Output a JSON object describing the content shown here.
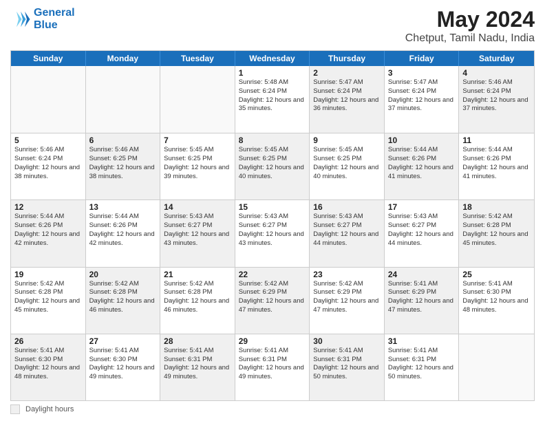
{
  "header": {
    "logo_line1": "General",
    "logo_line2": "Blue",
    "main_title": "May 2024",
    "subtitle": "Chetput, Tamil Nadu, India"
  },
  "weekdays": [
    "Sunday",
    "Monday",
    "Tuesday",
    "Wednesday",
    "Thursday",
    "Friday",
    "Saturday"
  ],
  "legend": {
    "box_label": "Daylight hours"
  },
  "weeks": [
    [
      {
        "day": "",
        "info": "",
        "empty": true
      },
      {
        "day": "",
        "info": "",
        "empty": true
      },
      {
        "day": "",
        "info": "",
        "empty": true
      },
      {
        "day": "1",
        "info": "Sunrise: 5:48 AM\nSunset: 6:24 PM\nDaylight: 12 hours\nand 35 minutes.",
        "empty": false,
        "shaded": false
      },
      {
        "day": "2",
        "info": "Sunrise: 5:47 AM\nSunset: 6:24 PM\nDaylight: 12 hours\nand 36 minutes.",
        "empty": false,
        "shaded": true
      },
      {
        "day": "3",
        "info": "Sunrise: 5:47 AM\nSunset: 6:24 PM\nDaylight: 12 hours\nand 37 minutes.",
        "empty": false,
        "shaded": false
      },
      {
        "day": "4",
        "info": "Sunrise: 5:46 AM\nSunset: 6:24 PM\nDaylight: 12 hours\nand 37 minutes.",
        "empty": false,
        "shaded": true
      }
    ],
    [
      {
        "day": "5",
        "info": "Sunrise: 5:46 AM\nSunset: 6:24 PM\nDaylight: 12 hours\nand 38 minutes.",
        "empty": false,
        "shaded": false
      },
      {
        "day": "6",
        "info": "Sunrise: 5:46 AM\nSunset: 6:25 PM\nDaylight: 12 hours\nand 38 minutes.",
        "empty": false,
        "shaded": true
      },
      {
        "day": "7",
        "info": "Sunrise: 5:45 AM\nSunset: 6:25 PM\nDaylight: 12 hours\nand 39 minutes.",
        "empty": false,
        "shaded": false
      },
      {
        "day": "8",
        "info": "Sunrise: 5:45 AM\nSunset: 6:25 PM\nDaylight: 12 hours\nand 40 minutes.",
        "empty": false,
        "shaded": true
      },
      {
        "day": "9",
        "info": "Sunrise: 5:45 AM\nSunset: 6:25 PM\nDaylight: 12 hours\nand 40 minutes.",
        "empty": false,
        "shaded": false
      },
      {
        "day": "10",
        "info": "Sunrise: 5:44 AM\nSunset: 6:26 PM\nDaylight: 12 hours\nand 41 minutes.",
        "empty": false,
        "shaded": true
      },
      {
        "day": "11",
        "info": "Sunrise: 5:44 AM\nSunset: 6:26 PM\nDaylight: 12 hours\nand 41 minutes.",
        "empty": false,
        "shaded": false
      }
    ],
    [
      {
        "day": "12",
        "info": "Sunrise: 5:44 AM\nSunset: 6:26 PM\nDaylight: 12 hours\nand 42 minutes.",
        "empty": false,
        "shaded": true
      },
      {
        "day": "13",
        "info": "Sunrise: 5:44 AM\nSunset: 6:26 PM\nDaylight: 12 hours\nand 42 minutes.",
        "empty": false,
        "shaded": false
      },
      {
        "day": "14",
        "info": "Sunrise: 5:43 AM\nSunset: 6:27 PM\nDaylight: 12 hours\nand 43 minutes.",
        "empty": false,
        "shaded": true
      },
      {
        "day": "15",
        "info": "Sunrise: 5:43 AM\nSunset: 6:27 PM\nDaylight: 12 hours\nand 43 minutes.",
        "empty": false,
        "shaded": false
      },
      {
        "day": "16",
        "info": "Sunrise: 5:43 AM\nSunset: 6:27 PM\nDaylight: 12 hours\nand 44 minutes.",
        "empty": false,
        "shaded": true
      },
      {
        "day": "17",
        "info": "Sunrise: 5:43 AM\nSunset: 6:27 PM\nDaylight: 12 hours\nand 44 minutes.",
        "empty": false,
        "shaded": false
      },
      {
        "day": "18",
        "info": "Sunrise: 5:42 AM\nSunset: 6:28 PM\nDaylight: 12 hours\nand 45 minutes.",
        "empty": false,
        "shaded": true
      }
    ],
    [
      {
        "day": "19",
        "info": "Sunrise: 5:42 AM\nSunset: 6:28 PM\nDaylight: 12 hours\nand 45 minutes.",
        "empty": false,
        "shaded": false
      },
      {
        "day": "20",
        "info": "Sunrise: 5:42 AM\nSunset: 6:28 PM\nDaylight: 12 hours\nand 46 minutes.",
        "empty": false,
        "shaded": true
      },
      {
        "day": "21",
        "info": "Sunrise: 5:42 AM\nSunset: 6:28 PM\nDaylight: 12 hours\nand 46 minutes.",
        "empty": false,
        "shaded": false
      },
      {
        "day": "22",
        "info": "Sunrise: 5:42 AM\nSunset: 6:29 PM\nDaylight: 12 hours\nand 47 minutes.",
        "empty": false,
        "shaded": true
      },
      {
        "day": "23",
        "info": "Sunrise: 5:42 AM\nSunset: 6:29 PM\nDaylight: 12 hours\nand 47 minutes.",
        "empty": false,
        "shaded": false
      },
      {
        "day": "24",
        "info": "Sunrise: 5:41 AM\nSunset: 6:29 PM\nDaylight: 12 hours\nand 47 minutes.",
        "empty": false,
        "shaded": true
      },
      {
        "day": "25",
        "info": "Sunrise: 5:41 AM\nSunset: 6:30 PM\nDaylight: 12 hours\nand 48 minutes.",
        "empty": false,
        "shaded": false
      }
    ],
    [
      {
        "day": "26",
        "info": "Sunrise: 5:41 AM\nSunset: 6:30 PM\nDaylight: 12 hours\nand 48 minutes.",
        "empty": false,
        "shaded": true
      },
      {
        "day": "27",
        "info": "Sunrise: 5:41 AM\nSunset: 6:30 PM\nDaylight: 12 hours\nand 49 minutes.",
        "empty": false,
        "shaded": false
      },
      {
        "day": "28",
        "info": "Sunrise: 5:41 AM\nSunset: 6:31 PM\nDaylight: 12 hours\nand 49 minutes.",
        "empty": false,
        "shaded": true
      },
      {
        "day": "29",
        "info": "Sunrise: 5:41 AM\nSunset: 6:31 PM\nDaylight: 12 hours\nand 49 minutes.",
        "empty": false,
        "shaded": false
      },
      {
        "day": "30",
        "info": "Sunrise: 5:41 AM\nSunset: 6:31 PM\nDaylight: 12 hours\nand 50 minutes.",
        "empty": false,
        "shaded": true
      },
      {
        "day": "31",
        "info": "Sunrise: 5:41 AM\nSunset: 6:31 PM\nDaylight: 12 hours\nand 50 minutes.",
        "empty": false,
        "shaded": false
      },
      {
        "day": "",
        "info": "",
        "empty": true
      }
    ]
  ]
}
